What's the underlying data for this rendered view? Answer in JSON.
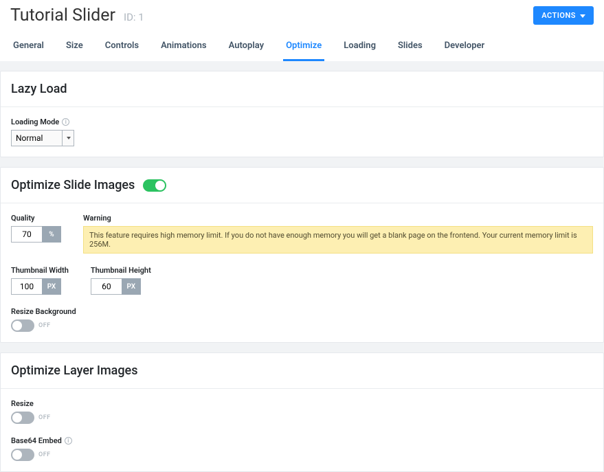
{
  "header": {
    "title": "Tutorial Slider",
    "id_label": "ID: 1",
    "actions_label": "ACTIONS"
  },
  "tabs": {
    "general": "General",
    "size": "Size",
    "controls": "Controls",
    "animations": "Animations",
    "autoplay": "Autoplay",
    "optimize": "Optimize",
    "loading": "Loading",
    "slides": "Slides",
    "developer": "Developer"
  },
  "lazy": {
    "heading": "Lazy Load",
    "loading_mode_label": "Loading Mode",
    "loading_mode_value": "Normal"
  },
  "opt_slide": {
    "heading": "Optimize Slide Images",
    "quality_label": "Quality",
    "quality_value": "70",
    "quality_unit": "%",
    "warning_label": "Warning",
    "warning_text": "This feature requires high memory limit. If you do not have enough memory you will get a blank page on the frontend. Your current memory limit is 256M.",
    "thumb_w_label": "Thumbnail Width",
    "thumb_w_value": "100",
    "thumb_h_label": "Thumbnail Height",
    "thumb_h_value": "60",
    "px_unit": "PX",
    "resize_bg_label": "Resize Background",
    "off_label": "OFF"
  },
  "opt_layer": {
    "heading": "Optimize Layer Images",
    "resize_label": "Resize",
    "b64_label": "Base64 Embed",
    "off_label": "OFF"
  },
  "info_char": "i"
}
